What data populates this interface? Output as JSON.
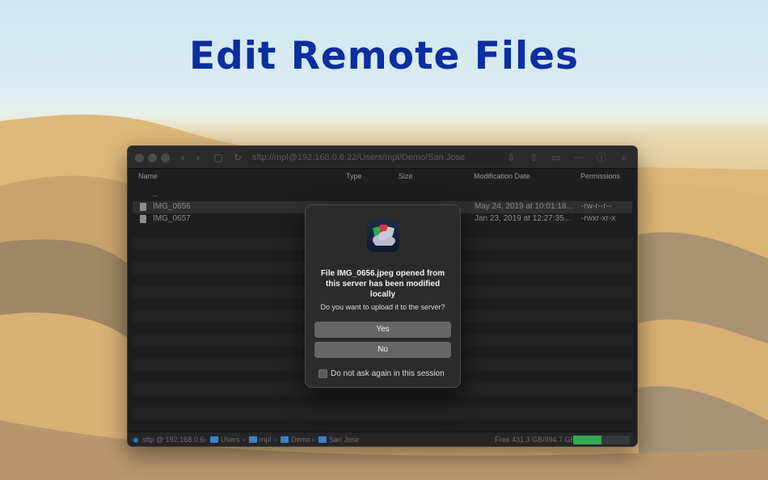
{
  "headline": "Edit Remote Files",
  "window": {
    "path": "sftp://mpl@192.168.0.6:22/Users/mpl/Demo/San Jose",
    "columns": {
      "name": "Name",
      "type": "Type",
      "size": "Size",
      "modified": "Modification Date",
      "permissions": "Permissions"
    },
    "parent_row": "..",
    "files": [
      {
        "name": "IMG_0656",
        "type": "",
        "size": "",
        "modified": "May 24, 2019 at 10:01:18...",
        "permissions": "-rw-r--r--"
      },
      {
        "name": "IMG_0657",
        "type": "",
        "size": "",
        "modified": "Jan 23, 2019 at 12:27:35...",
        "permissions": "-rwxr-xr-x"
      }
    ],
    "status": {
      "connection": "sftp @ 192.168.0.6",
      "crumbs": [
        "Users",
        "mpl",
        "Demo",
        "San Jose"
      ],
      "free_space": "Free 431.3 GB/994.7 GB",
      "disk_used_fraction": 0.5
    }
  },
  "dialog": {
    "title": "File IMG_0656.jpeg opened from this server has been modified locally",
    "message": "Do you want to upload it to the server?",
    "yes_label": "Yes",
    "no_label": "No",
    "checkbox_label": "Do not ask again in this session"
  },
  "colors": {
    "headline": "#0b2ea0",
    "accent_folder": "#3b83c4",
    "disk_fill": "#34a853"
  }
}
